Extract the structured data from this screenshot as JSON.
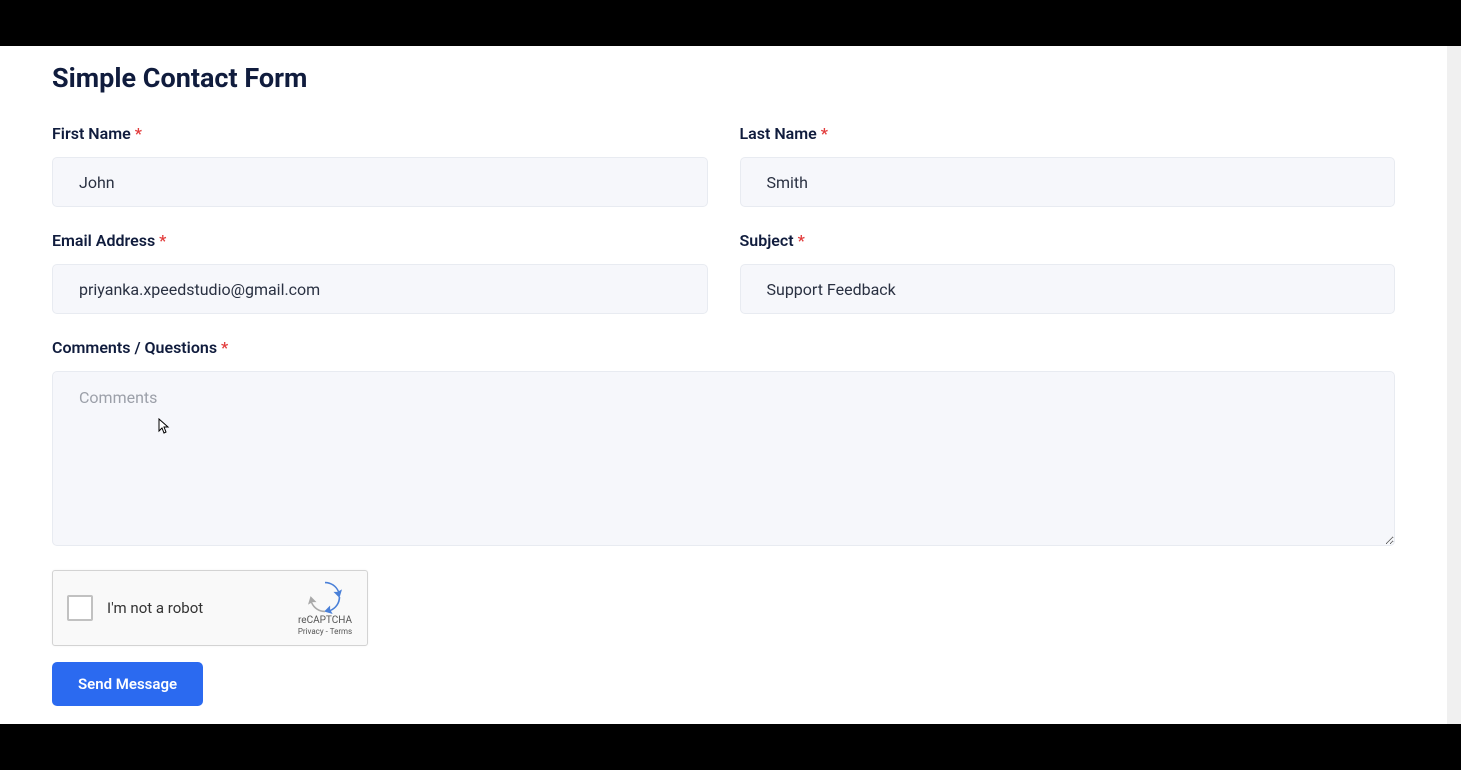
{
  "page": {
    "title": "Simple Contact Form"
  },
  "form": {
    "first_name": {
      "label": "First Name",
      "value": "John",
      "placeholder": ""
    },
    "last_name": {
      "label": "Last Name",
      "value": "Smith",
      "placeholder": ""
    },
    "email": {
      "label": "Email Address",
      "value": "priyanka.xpeedstudio@gmail.com",
      "placeholder": ""
    },
    "subject": {
      "label": "Subject",
      "value": "Support Feedback",
      "placeholder": ""
    },
    "comments": {
      "label": "Comments / Questions",
      "value": "",
      "placeholder": "Comments"
    },
    "required_marker": "*"
  },
  "recaptcha": {
    "label": "I'm not a robot",
    "brand": "reCAPTCHA",
    "privacy": "Privacy",
    "terms": "Terms",
    "separator": " - "
  },
  "submit": {
    "label": "Send Message"
  }
}
